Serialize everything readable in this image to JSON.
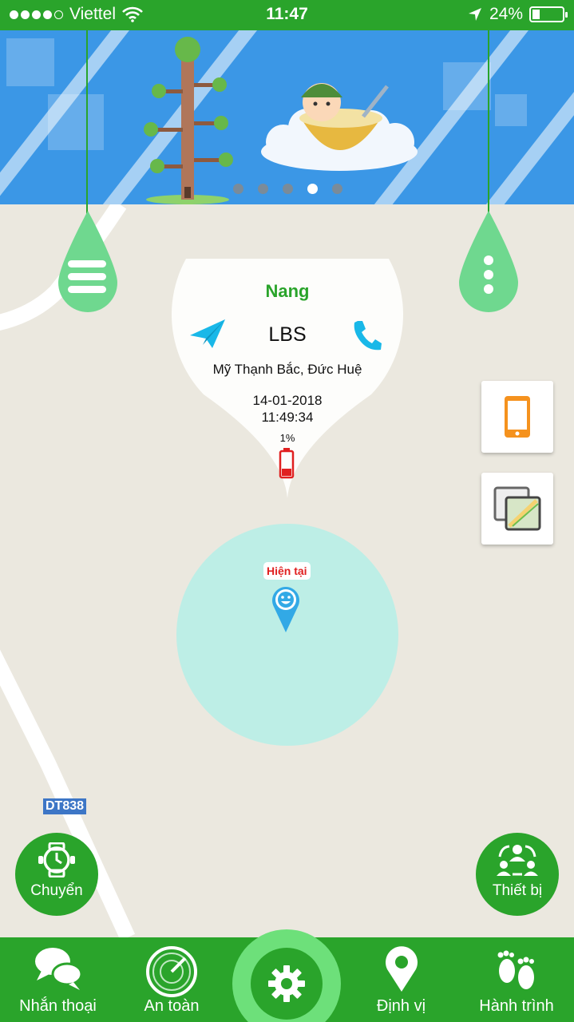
{
  "status_bar": {
    "carrier": "Viettel",
    "time": "11:47",
    "battery": "24%",
    "battery_level": 0.24
  },
  "banner": {
    "slides": 5,
    "active_slide": 4
  },
  "map": {
    "road_label": "DT838"
  },
  "info_bubble": {
    "name": "Nang",
    "source": "LBS",
    "address": "Mỹ Thạnh Bắc, Đức Huệ",
    "date": "14-01-2018",
    "time": "11:49:34",
    "battery": "1%",
    "battery_level": 0.01
  },
  "marker": {
    "label": "Hiện tại"
  },
  "floating": {
    "switch_label": "Chuyển",
    "devices_label": "Thiết bị"
  },
  "tabs": [
    {
      "label": "Nhắn thoại",
      "icon": "chat-icon"
    },
    {
      "label": "An toàn",
      "icon": "radar-icon"
    },
    {
      "label": "",
      "icon": "gear-icon"
    },
    {
      "label": "Định vị",
      "icon": "location-pin-icon"
    },
    {
      "label": "Hành trình",
      "icon": "footprints-icon"
    }
  ],
  "colors": {
    "brand_green": "#2aa42b",
    "accuracy_circle": "#bdeee6",
    "banner_blue": "#3b97e6",
    "highlight_red": "#e02020"
  }
}
